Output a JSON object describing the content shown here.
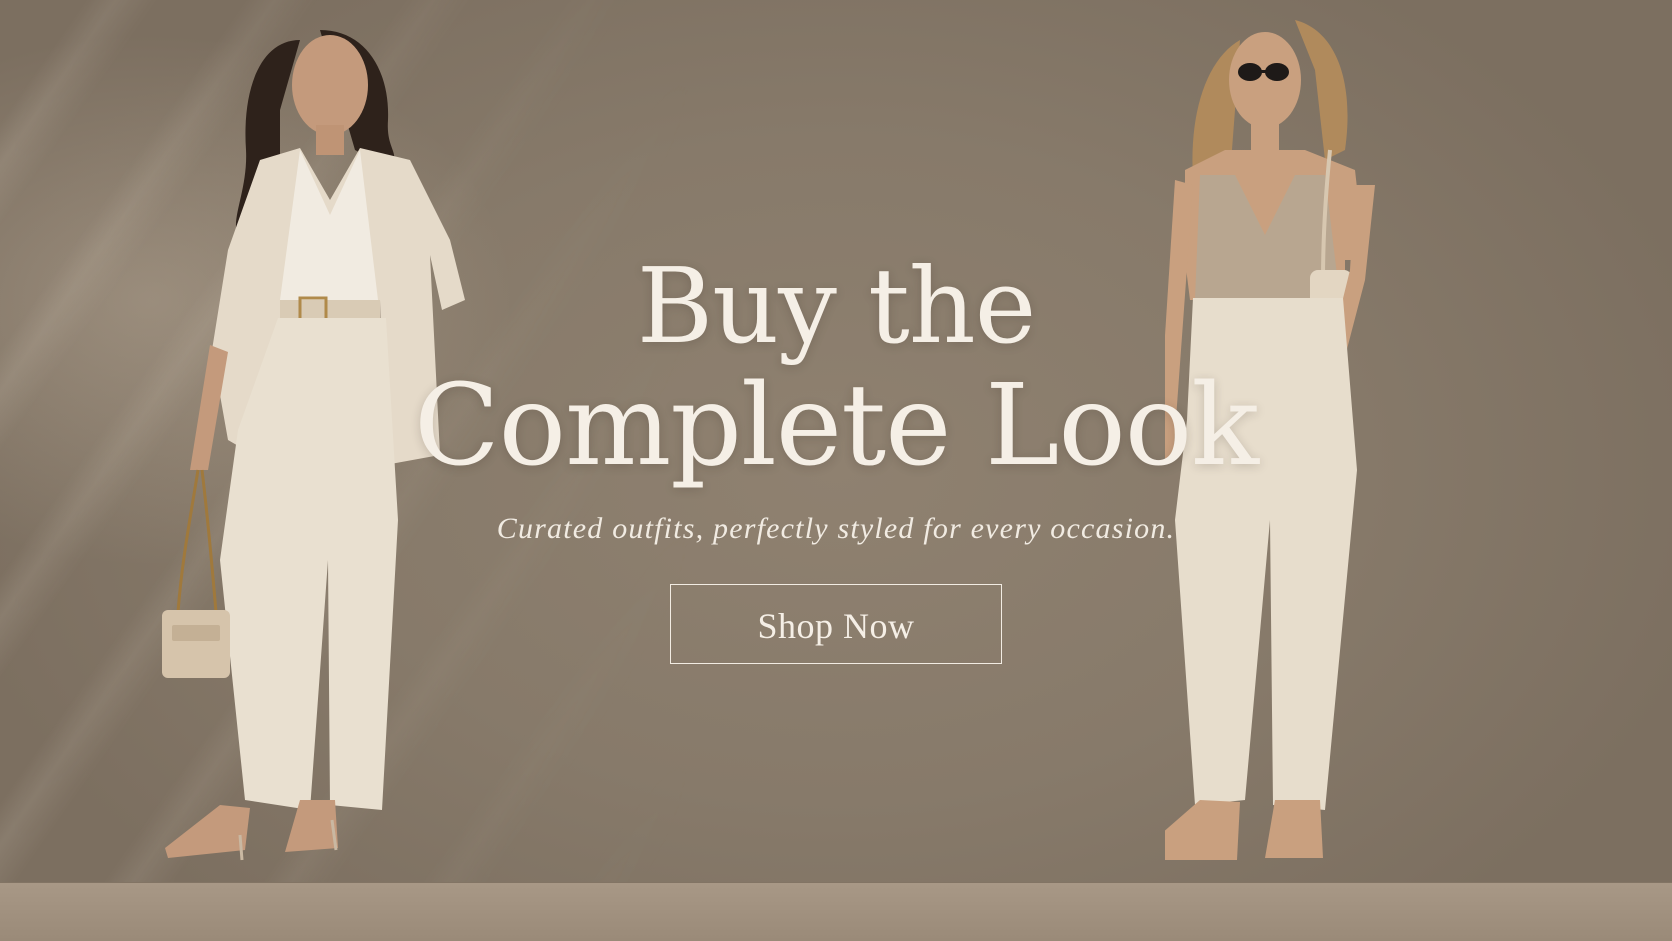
{
  "hero": {
    "headline_line1": "Buy the",
    "headline_line2": "Complete Look",
    "subtitle": "Curated outfits, perfectly styled for every occasion.",
    "cta_label": "Shop Now"
  },
  "colors": {
    "background_wall": "#877a6a",
    "text": "#f5efe6",
    "outfit_cream": "#ebe1d1"
  }
}
